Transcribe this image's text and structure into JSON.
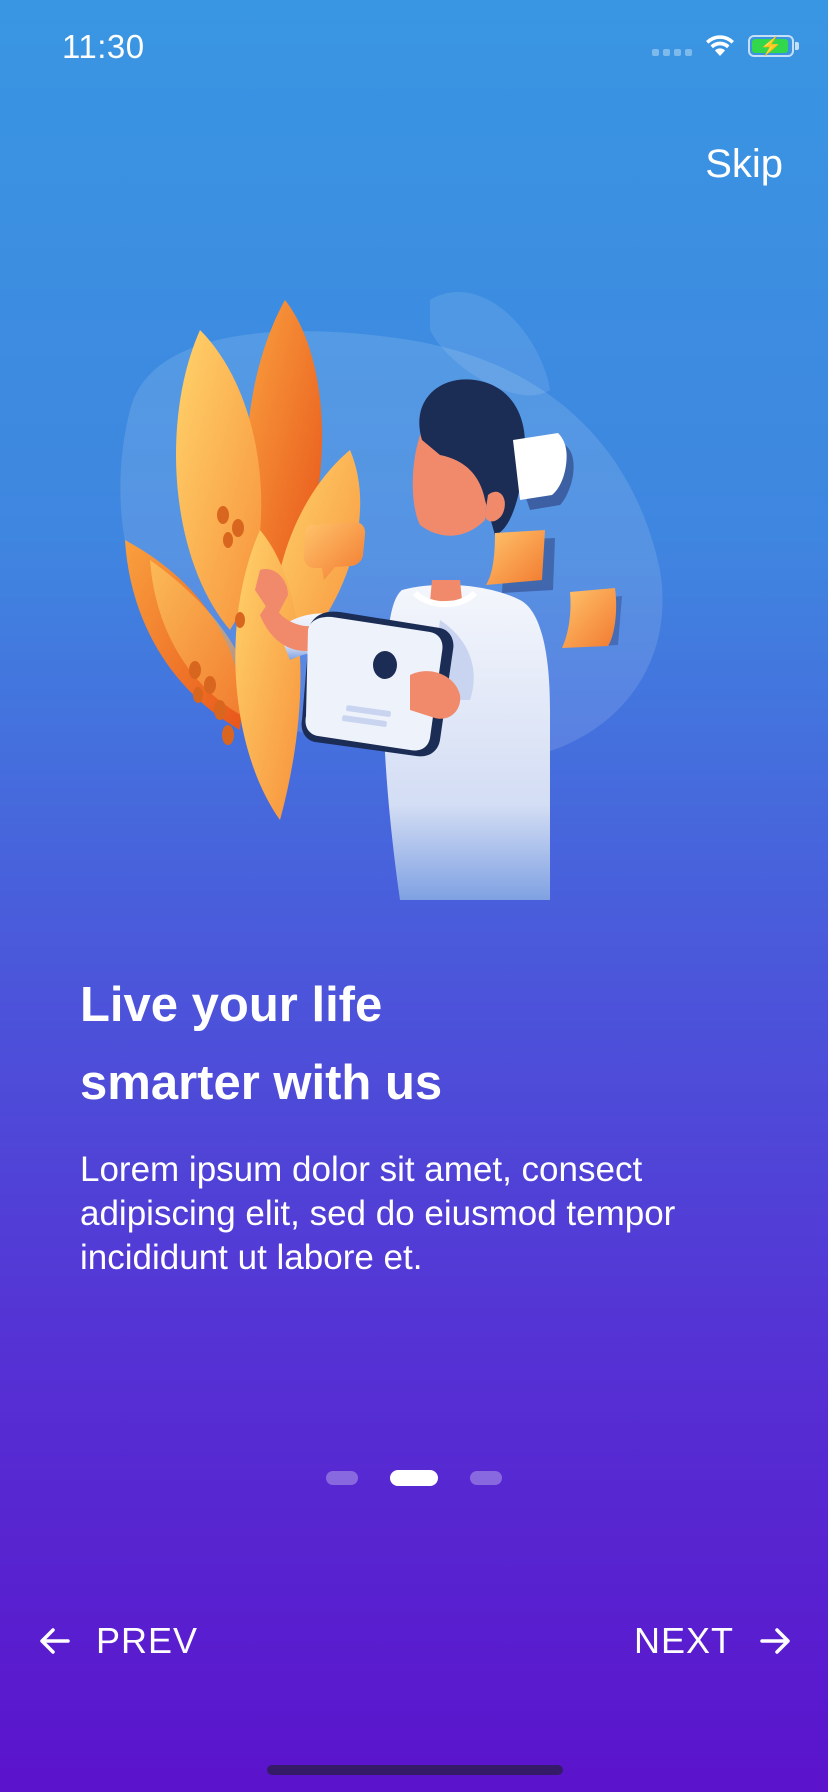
{
  "status_bar": {
    "time": "11:30",
    "icons": [
      "cellular-signal-icon",
      "wifi-icon",
      "battery-charging-icon"
    ],
    "battery_color": "#32D74B"
  },
  "header": {
    "skip_label": "Skip"
  },
  "illustration": {
    "icon": "person-with-tablet-illustration",
    "colors": {
      "leaf": "#F7A13B",
      "leaf_light": "#FFD36B",
      "shirt": "#E9EEF9",
      "hair": "#1C2D55",
      "skin": "#F08A6B"
    }
  },
  "content": {
    "title_line1": "Live your life",
    "title_line2": "smarter with us",
    "description": "Lorem ipsum dolor sit amet, consect adipiscing elit, sed do eiusmod tempor incididunt ut labore et."
  },
  "pagination": {
    "count": 3,
    "active_index": 1
  },
  "footer": {
    "prev_label": "PREV",
    "next_label": "NEXT",
    "prev_icon": "arrow-left-icon",
    "next_icon": "arrow-right-icon"
  },
  "colors": {
    "gradient_top": "#3996E2",
    "gradient_bottom": "#5B13CC",
    "text": "#FFFFFF"
  }
}
